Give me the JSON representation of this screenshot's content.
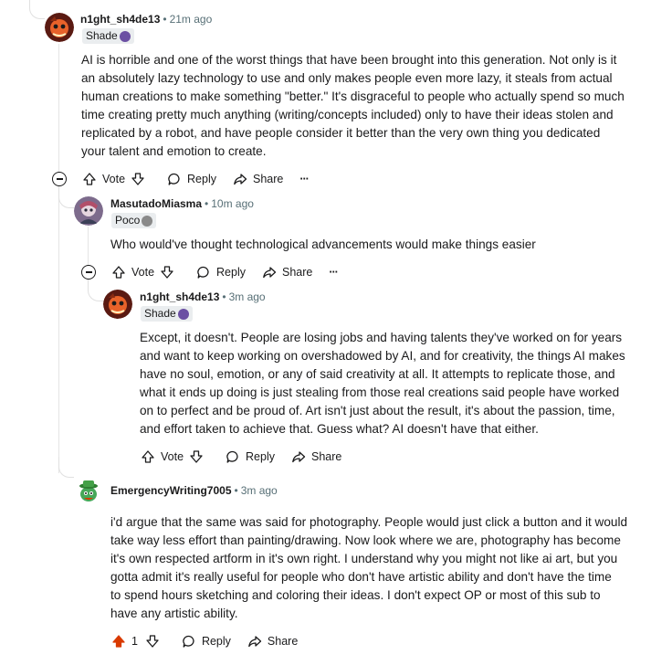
{
  "c1": {
    "author": "n1ght_sh4de13",
    "time": "21m ago",
    "flair": "Shade",
    "body": "AI is horrible and one of the worst things that have been brought into this generation. Not only is it\nan absolutely lazy technology to use and only makes people even more lazy, it steals from actual\nhuman creations to make something \"better.\" It's disgraceful to people who actually spend so much\ntime creating pretty much anything (writing/concepts included) only to have their ideas stolen and\nreplicated by a robot, and have people consider it better than the very own thing you dedicated\nyour talent and emotion to create.",
    "vote": "Vote",
    "reply": "Reply",
    "share": "Share",
    "more": "···"
  },
  "c2": {
    "author": "MasutadoMiasma",
    "time": "10m ago",
    "flair": "Poco",
    "body": "Who would've thought technological advancements would make things easier",
    "vote": "Vote",
    "reply": "Reply",
    "share": "Share",
    "more": "···"
  },
  "c3": {
    "author": "n1ght_sh4de13",
    "time": "3m ago",
    "flair": "Shade",
    "body": "Except, it doesn't. People are losing jobs and having talents they've worked on for years\nand want to keep working on overshadowed by AI, and for creativity, the things AI makes\nhave no soul, emotion, or any of said creativity at all. It attempts to replicate those, and\nwhat it ends up doing is just stealing from those real creations said people have worked\non to perfect and be proud of. Art isn't just about the result, it's about the passion, time,\nand effort taken to achieve that. Guess what? AI doesn't have that either.",
    "vote": "Vote",
    "reply": "Reply",
    "share": "Share"
  },
  "c4": {
    "author": "EmergencyWriting7005",
    "time": "3m ago",
    "body": "i'd argue that the same was said for photography. People would just click a button and it would\ntake way less effort than painting/drawing. Now look where we are, photography has become\nit's own respected artform in it's own right. I understand why you might not like ai art, but you\ngotta admit it's really useful for people who don't have artistic ability and don't have the time\nto spend hours sketching and coloring their ideas. I don't expect OP or most of this sub to\nhave any artistic ability.",
    "votes": "1",
    "reply": "Reply",
    "share": "Share"
  },
  "colors": {
    "upvoted": "#d93a00",
    "meta": "#576f76",
    "flair_bg": "#eaedef"
  },
  "icons": [
    "upvote-icon",
    "downvote-icon",
    "reply-icon",
    "share-icon",
    "more-icon",
    "collapse-icon"
  ]
}
